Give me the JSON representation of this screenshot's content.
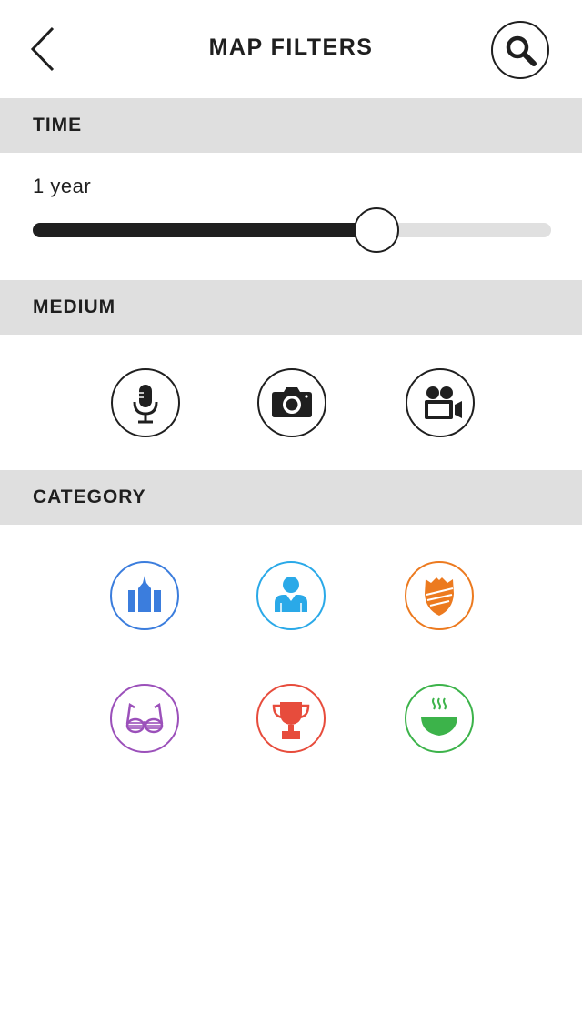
{
  "header": {
    "title": "MAP FILTERS",
    "back_icon": "chevron-left-icon",
    "search_icon": "search-icon"
  },
  "time": {
    "section_label": "TIME",
    "value_label": "1 year",
    "slider_fraction": 0.663
  },
  "medium": {
    "section_label": "MEDIUM",
    "items": [
      {
        "icon": "microphone-icon"
      },
      {
        "icon": "camera-icon"
      },
      {
        "icon": "video-camera-icon"
      }
    ]
  },
  "category": {
    "section_label": "CATEGORY",
    "items": [
      {
        "icon": "city-buildings-icon",
        "color": "#3b7ddd"
      },
      {
        "icon": "person-icon",
        "color": "#2aa9e8"
      },
      {
        "icon": "shield-icon",
        "color": "#ec7a1f"
      },
      {
        "icon": "party-glasses-icon",
        "color": "#9b50ba"
      },
      {
        "icon": "trophy-icon",
        "color": "#e74c3c"
      },
      {
        "icon": "soup-bowl-icon",
        "color": "#3cb34a"
      }
    ]
  },
  "colors": {
    "text": "#1f1f1f",
    "section_background": "#dfdfdf",
    "track": "#e0e0e0"
  }
}
